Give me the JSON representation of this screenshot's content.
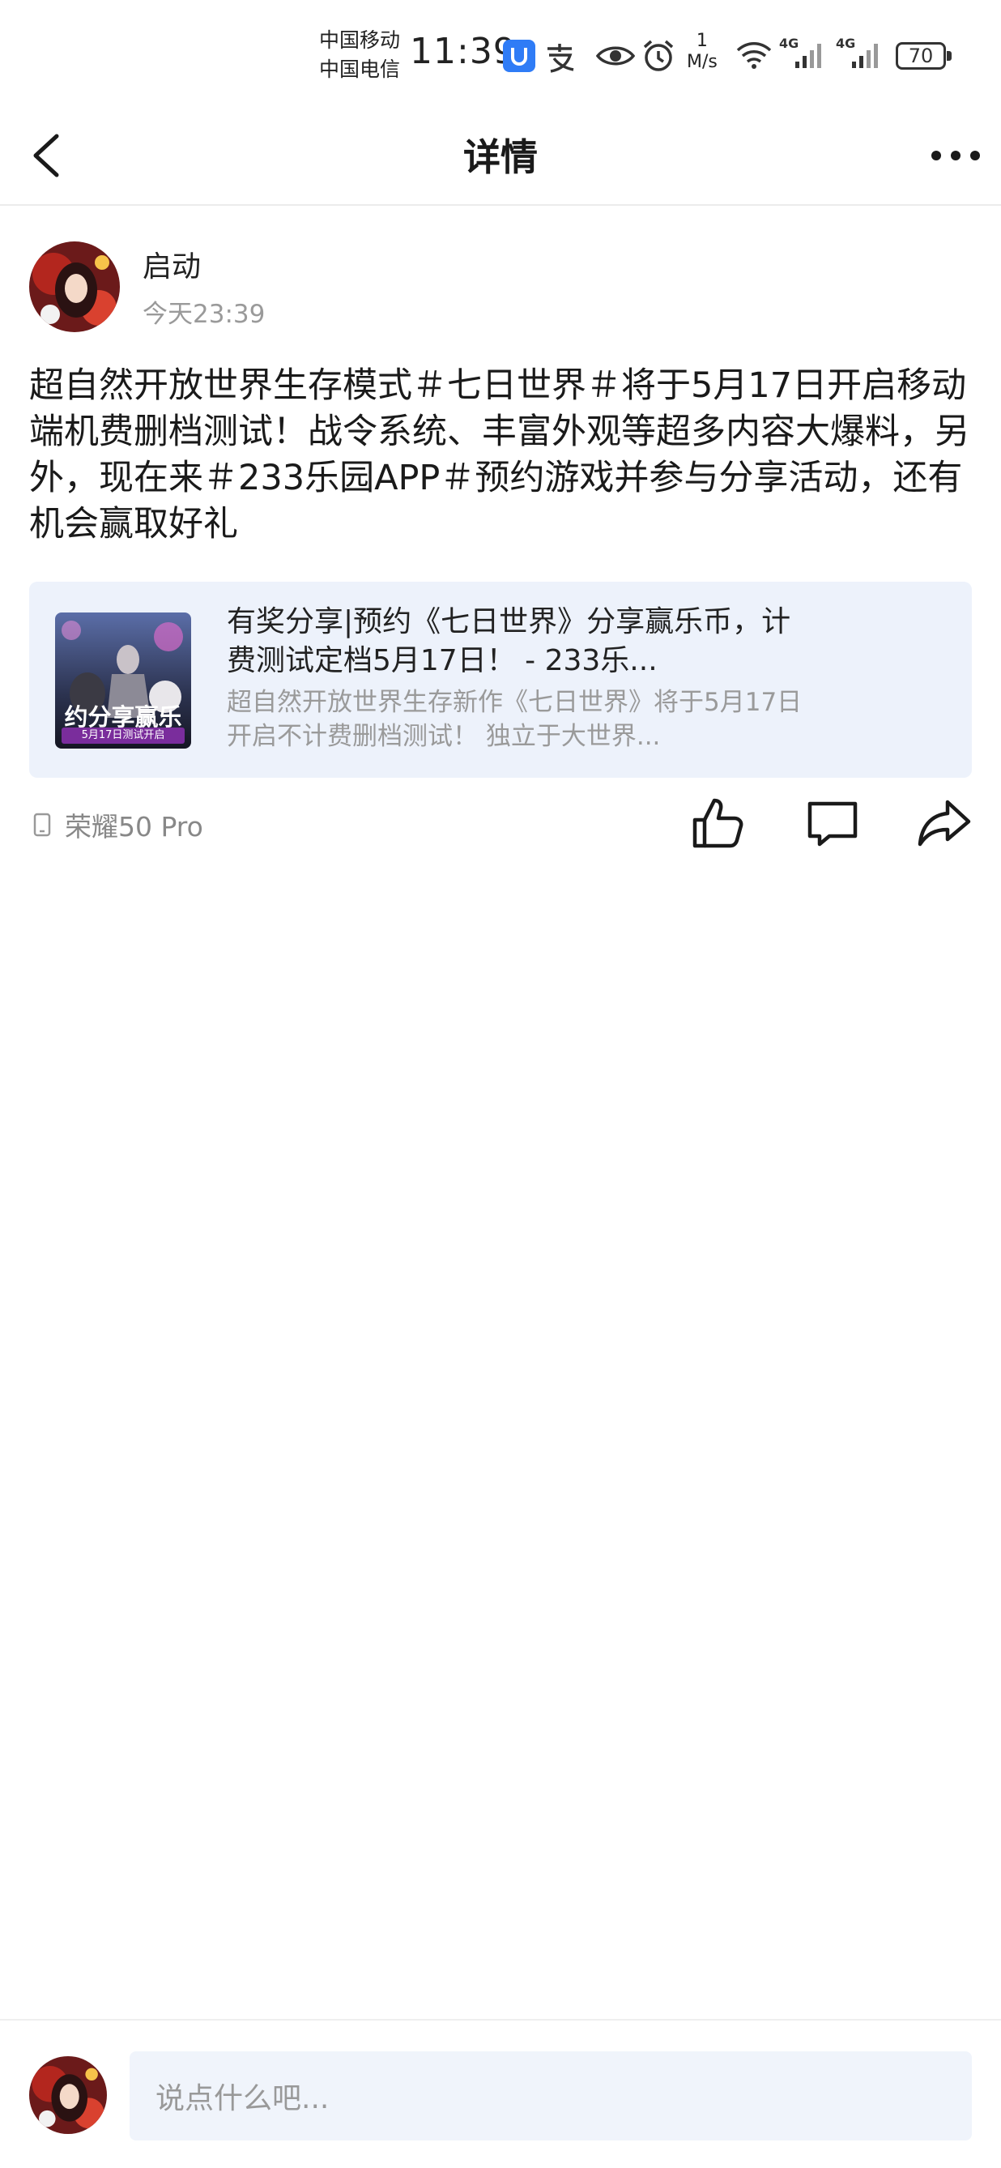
{
  "status_bar": {
    "carrier_1": "中国移动",
    "carrier_2": "中国电信",
    "time": "11:39",
    "speed_value": "1",
    "speed_unit": "M/s",
    "network_1": "4G",
    "network_2": "4G",
    "battery": "70"
  },
  "nav": {
    "title": "详情"
  },
  "post": {
    "author": "启动",
    "time": "今天23:39",
    "body": "超自然开放世界生存模式＃七日世界＃将于5月17日开启移动端机费删档测试！战令系统、丰富外观等超多内容大爆料，另外，现在来＃233乐园APP＃预约游戏并参与分享活动，还有机会赢取好礼",
    "card": {
      "thumb_text": "约分享赢乐",
      "thumb_subtext": "5月17日测试开启",
      "title": "有奖分享|预约《七日世界》分享赢乐币，计费测试定档5月17日！ - 233乐...",
      "desc": "超自然开放世界生存新作《七日世界》将于5月17日开启不计费删档测试！ 独立于大世界..."
    },
    "device": "荣耀50 Pro"
  },
  "comment": {
    "placeholder": "说点什么吧..."
  },
  "colors": {
    "card_bg": "#edf2fb",
    "input_bg": "#f0f4fb",
    "muted_text": "#9a9a9a"
  },
  "icons": [
    "back-arrow-icon",
    "more-dots-icon",
    "phone-device-icon",
    "thumbs-up-icon",
    "comment-icon",
    "share-icon",
    "wifi-icon",
    "signal-icon",
    "eye-icon",
    "alarm-icon",
    "battery-icon"
  ]
}
